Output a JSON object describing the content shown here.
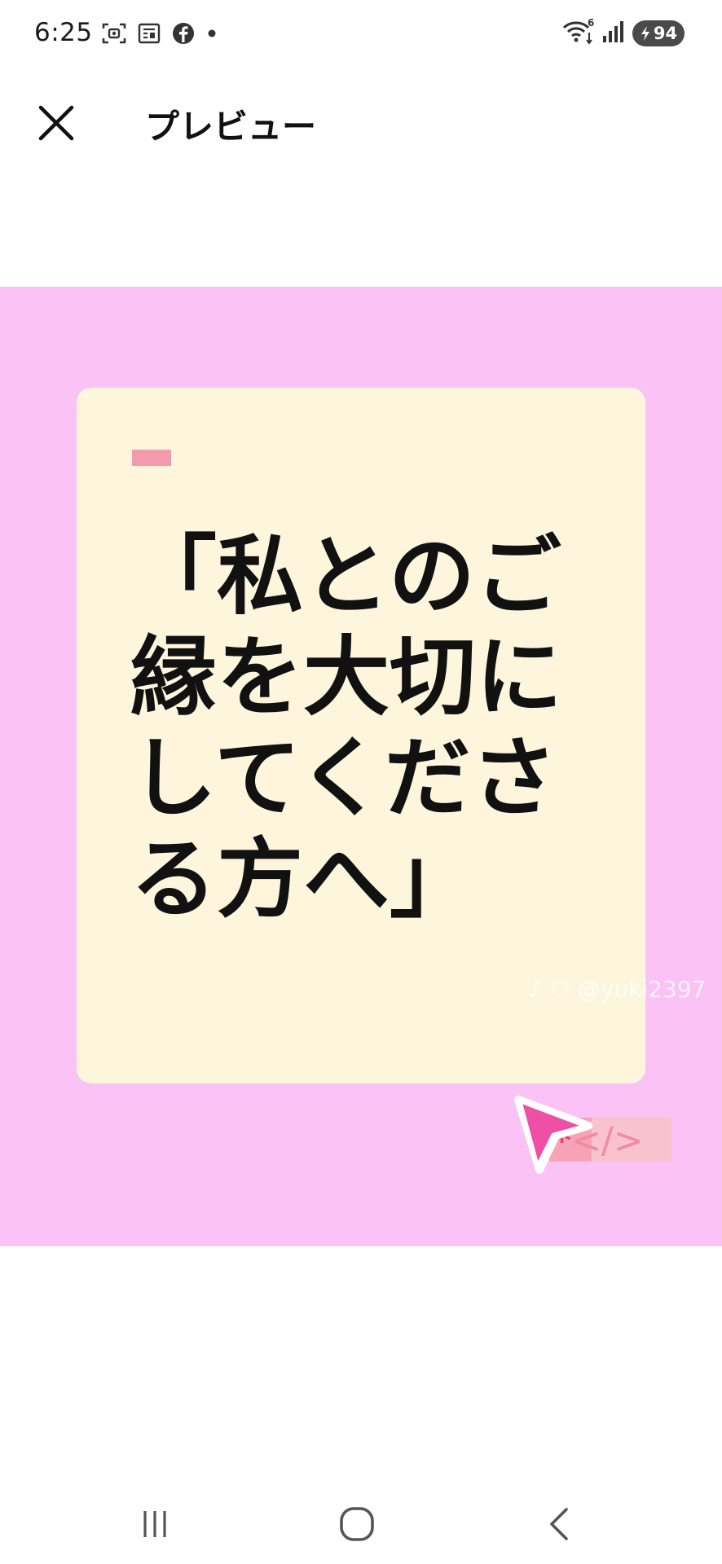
{
  "status_bar": {
    "time": "6:25",
    "left_icons": [
      "screenshot-icon",
      "news-icon",
      "facebook-icon",
      "notification-dot-icon"
    ],
    "right_icons": [
      "wifi-icon",
      "signal-icon"
    ],
    "wifi_badge": "6",
    "battery_level": "94"
  },
  "app_bar": {
    "close_icon": "close-icon",
    "title": "プレビュー"
  },
  "preview": {
    "background_color": "#fbc2f6",
    "card_color": "#fdf6dd",
    "quote": "「私とのご縁を大切にしてくださる方へ」",
    "watermark": "♪ ⚇ @yuki2397",
    "code_asterisk": "*",
    "code_symbol": "</>",
    "accent_color": "#f04fa8"
  },
  "nav_bar": {
    "buttons": [
      "recent-apps-icon",
      "home-icon",
      "back-icon"
    ]
  }
}
